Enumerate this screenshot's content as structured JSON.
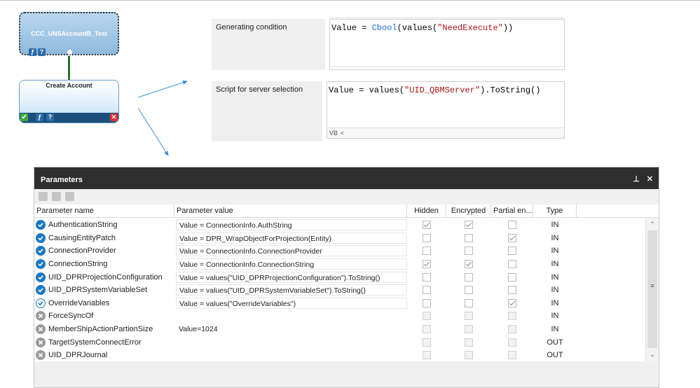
{
  "workflow": {
    "top_node_title": "CCC_UNSAccountB_Test",
    "main_node_title": "Create Account"
  },
  "properties": {
    "generating_condition": {
      "label": "Generating condition",
      "code_prefix": "Value = ",
      "code_func": "Cbool",
      "code_mid": "(values(",
      "code_str": "\"NeedExecute\"",
      "code_suffix": "))"
    },
    "server_selection": {
      "label": "Script for server selection",
      "code_prefix": "Value = values(",
      "code_str": "\"UID_QBMServer\"",
      "code_suffix": ").ToString()",
      "vb_label": "VB"
    }
  },
  "parameters_panel": {
    "title": "Parameters",
    "pin_icon": "pin-icon",
    "close_label": "✕",
    "columns": {
      "name": "Parameter name",
      "value": "Parameter value",
      "hidden": "Hidden",
      "encrypted": "Encrypted",
      "partial": "Partial en...",
      "type": "Type"
    },
    "rows": [
      {
        "name": "AuthenticationString",
        "value": "Value = ConnectionInfo.AuthString",
        "status": "ok",
        "hidden": true,
        "encrypted": true,
        "partial": false,
        "type": "IN"
      },
      {
        "name": "CausingEntityPatch",
        "value": "Value = DPR_WrapObjectForProjection(Entity)",
        "status": "ok",
        "hidden": false,
        "encrypted": false,
        "partial": true,
        "type": "IN"
      },
      {
        "name": "ConnectionProvider",
        "value": "Value = ConnectionInfo.ConnectionProvider",
        "status": "ok",
        "hidden": false,
        "encrypted": false,
        "partial": false,
        "type": "IN"
      },
      {
        "name": "ConnectionString",
        "value": "Value = ConnectionInfo.ConnectionString",
        "status": "ok",
        "hidden": true,
        "encrypted": true,
        "partial": false,
        "type": "IN"
      },
      {
        "name": "UID_DPRProjectionConfiguration",
        "value": "Value = values(\"UID_DPRProjectionConfiguration\").ToString()",
        "status": "ok",
        "hidden": false,
        "encrypted": false,
        "partial": false,
        "type": "IN"
      },
      {
        "name": "UID_DPRSystemVariableSet",
        "value": "Value = values(\"UID_DPRSystemVariableSet\").ToString()",
        "status": "ok",
        "hidden": false,
        "encrypted": false,
        "partial": false,
        "type": "IN"
      },
      {
        "name": "OverrideVariables",
        "value": "Value = values(\"OverrideVariables\")",
        "status": "ok-outline",
        "hidden": false,
        "encrypted": false,
        "partial": true,
        "type": "IN"
      },
      {
        "name": "ForceSyncOf",
        "value": "",
        "status": "off",
        "hidden": false,
        "encrypted": false,
        "partial": false,
        "type": "IN"
      },
      {
        "name": "MemberShipActionPartionSize",
        "value": "Value=1024",
        "status": "off",
        "hidden": false,
        "encrypted": false,
        "partial": false,
        "type": "IN"
      },
      {
        "name": "TargetSystemConnectError",
        "value": "",
        "status": "off",
        "hidden": false,
        "encrypted": false,
        "partial": false,
        "type": "OUT"
      },
      {
        "name": "UID_DPRJournal",
        "value": "",
        "status": "off",
        "hidden": false,
        "encrypted": false,
        "partial": false,
        "type": "OUT"
      }
    ]
  },
  "colors": {
    "accent": "#1e78c2",
    "header_bg": "#2e2e2e",
    "string": "#a31515",
    "keyword": "#1b6fd1"
  }
}
